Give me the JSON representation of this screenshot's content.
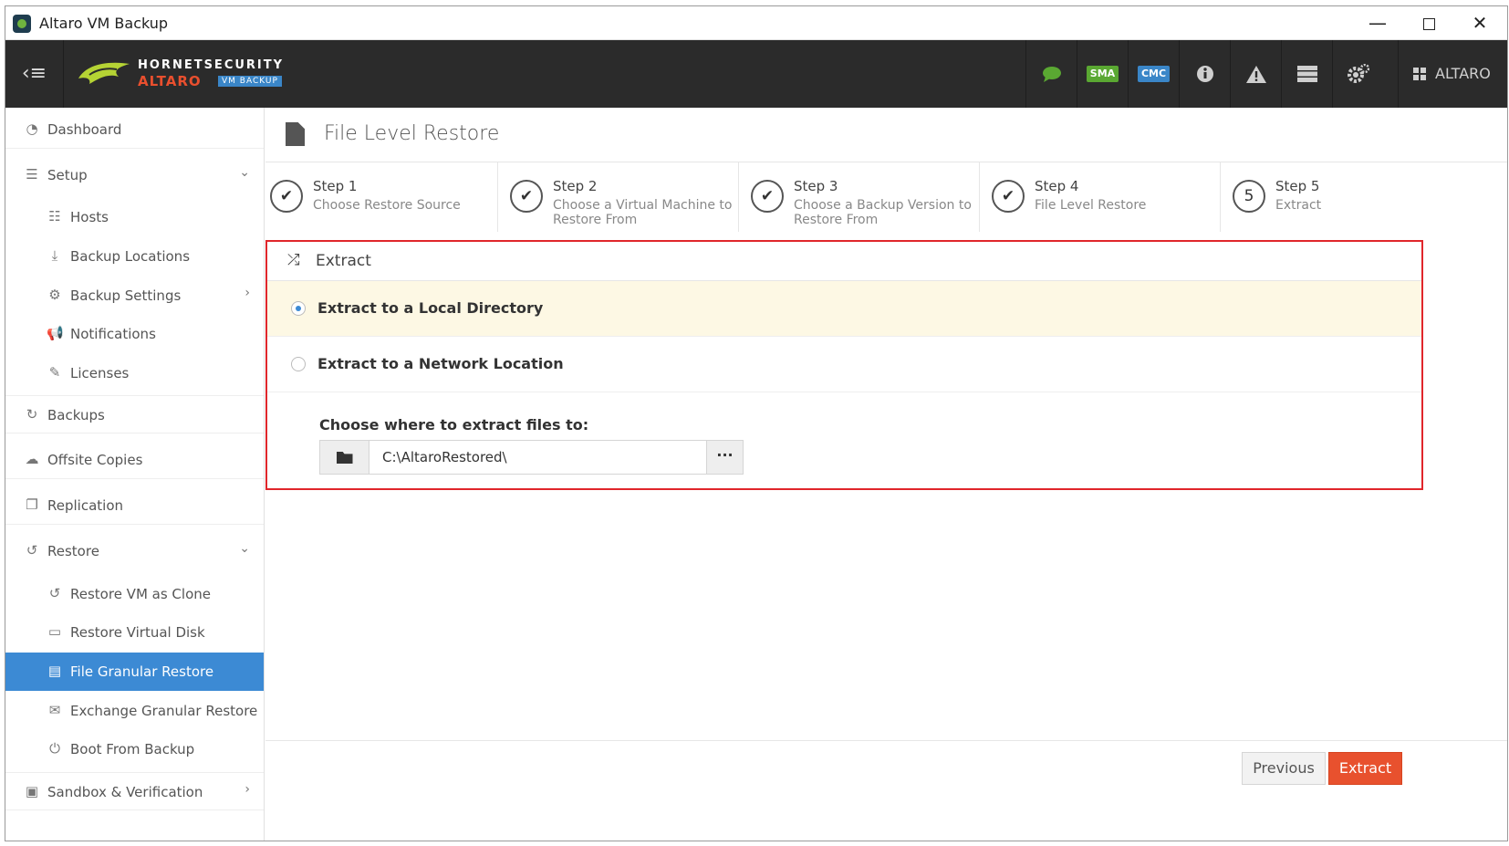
{
  "window": {
    "title": "Altaro VM Backup",
    "minimize": "—",
    "close": "✕"
  },
  "header": {
    "brand_line1": "HORNETSECURITY",
    "brand_line2": "ALTARO",
    "brand_badge": "VM BACKUP",
    "sma": "SMA",
    "cmc": "CMC",
    "sma_color": "#5aa832",
    "cmc_color": "#3a86c8",
    "user": "ALTARO"
  },
  "sidebar": {
    "items": [
      {
        "label": "Dashboard",
        "icon": "dashboard-icon"
      },
      {
        "label": "Setup",
        "icon": "sliders-icon"
      },
      {
        "label": "Hosts",
        "icon": "list-icon"
      },
      {
        "label": "Backup Locations",
        "icon": "download-icon"
      },
      {
        "label": "Backup Settings",
        "icon": "gears-icon"
      },
      {
        "label": "Notifications",
        "icon": "megaphone-icon"
      },
      {
        "label": "Licenses",
        "icon": "edit-icon"
      },
      {
        "label": "Backups",
        "icon": "refresh-icon"
      },
      {
        "label": "Offsite Copies",
        "icon": "cloud-upload-icon"
      },
      {
        "label": "Replication",
        "icon": "copy-icon"
      },
      {
        "label": "Restore",
        "icon": "undo-icon"
      },
      {
        "label": "Restore VM as Clone",
        "icon": "undo-icon"
      },
      {
        "label": "Restore Virtual Disk",
        "icon": "hdd-icon"
      },
      {
        "label": "File Granular Restore",
        "icon": "file-icon"
      },
      {
        "label": "Exchange Granular Restore",
        "icon": "envelope-icon"
      },
      {
        "label": "Boot From Backup",
        "icon": "power-icon"
      },
      {
        "label": "Sandbox & Verification",
        "icon": "archive-icon"
      }
    ],
    "active_color": "#3c8ad4"
  },
  "page": {
    "title": "File Level Restore"
  },
  "steps": [
    {
      "title": "Step 1",
      "desc": "Choose Restore Source",
      "marker": "✔"
    },
    {
      "title": "Step 2",
      "desc": "Choose a Virtual Machine to Restore From",
      "marker": "✔"
    },
    {
      "title": "Step 3",
      "desc": "Choose a Backup Version to Restore From",
      "marker": "✔"
    },
    {
      "title": "Step 4",
      "desc": "File Level Restore",
      "marker": "✔"
    },
    {
      "title": "Step 5",
      "desc": "Extract",
      "marker": "5"
    }
  ],
  "extract": {
    "heading": "Extract",
    "option_local": "Extract to a Local Directory",
    "option_network": "Extract to a Network Location",
    "path_label": "Choose where to extract files to:",
    "path_value": "C:\\AltaroRestored\\",
    "browse": "···"
  },
  "footer": {
    "previous": "Previous",
    "extract": "Extract"
  }
}
